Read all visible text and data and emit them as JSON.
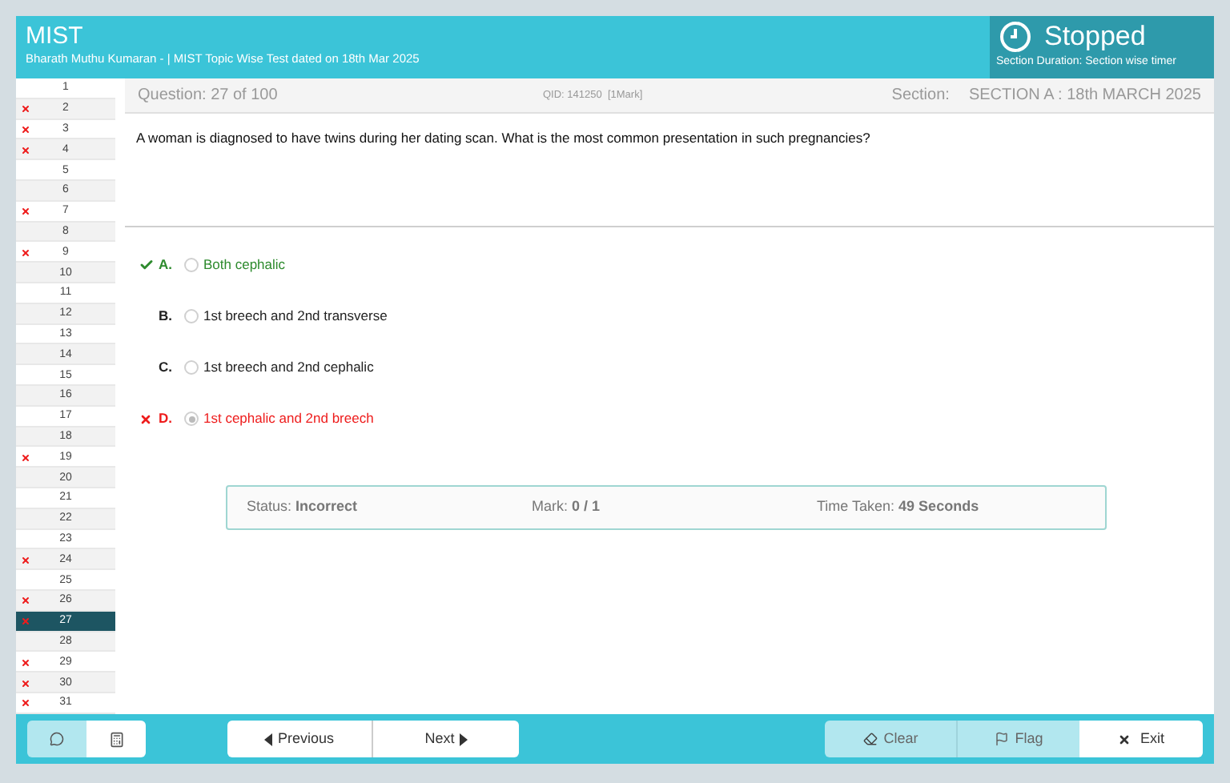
{
  "header": {
    "title": "MIST",
    "subtitle": "Bharath Muthu Kumaran - | MIST Topic Wise Test dated on 18th Mar 2025",
    "timer": {
      "state": "Stopped",
      "note": "Section Duration: Section wise timer"
    }
  },
  "questions": [
    {
      "number": "1",
      "wrong": false,
      "selected": false
    },
    {
      "number": "2",
      "wrong": true,
      "selected": false
    },
    {
      "number": "3",
      "wrong": true,
      "selected": false
    },
    {
      "number": "4",
      "wrong": true,
      "selected": false
    },
    {
      "number": "5",
      "wrong": false,
      "selected": false
    },
    {
      "number": "6",
      "wrong": false,
      "selected": false
    },
    {
      "number": "7",
      "wrong": true,
      "selected": false
    },
    {
      "number": "8",
      "wrong": false,
      "selected": false
    },
    {
      "number": "9",
      "wrong": true,
      "selected": false
    },
    {
      "number": "10",
      "wrong": false,
      "selected": false
    },
    {
      "number": "11",
      "wrong": false,
      "selected": false
    },
    {
      "number": "12",
      "wrong": false,
      "selected": false
    },
    {
      "number": "13",
      "wrong": false,
      "selected": false
    },
    {
      "number": "14",
      "wrong": false,
      "selected": false
    },
    {
      "number": "15",
      "wrong": false,
      "selected": false
    },
    {
      "number": "16",
      "wrong": false,
      "selected": false
    },
    {
      "number": "17",
      "wrong": false,
      "selected": false
    },
    {
      "number": "18",
      "wrong": false,
      "selected": false
    },
    {
      "number": "19",
      "wrong": true,
      "selected": false
    },
    {
      "number": "20",
      "wrong": false,
      "selected": false
    },
    {
      "number": "21",
      "wrong": false,
      "selected": false
    },
    {
      "number": "22",
      "wrong": false,
      "selected": false
    },
    {
      "number": "23",
      "wrong": false,
      "selected": false
    },
    {
      "number": "24",
      "wrong": true,
      "selected": false
    },
    {
      "number": "25",
      "wrong": false,
      "selected": false
    },
    {
      "number": "26",
      "wrong": true,
      "selected": false
    },
    {
      "number": "27",
      "wrong": true,
      "selected": true
    },
    {
      "number": "28",
      "wrong": false,
      "selected": false
    },
    {
      "number": "29",
      "wrong": true,
      "selected": false
    },
    {
      "number": "30",
      "wrong": true,
      "selected": false
    },
    {
      "number": "31",
      "wrong": true,
      "selected": false
    }
  ],
  "info_bar": {
    "question": "Question: 27 of 100",
    "qid": "QID: 141250  [1Mark]",
    "section_label": "Section:",
    "section": "SECTION A : 18th MARCH 2025"
  },
  "question_text": "A woman is diagnosed to have twins during her dating scan. What is the most common presentation in such pregnancies?",
  "options": [
    {
      "letter": "A.",
      "text": "Both cephalic",
      "kind": "correct",
      "selected": false
    },
    {
      "letter": "B.",
      "text": "1st breech and 2nd transverse",
      "kind": "plain",
      "selected": false
    },
    {
      "letter": "C.",
      "text": "1st breech and 2nd cephalic",
      "kind": "plain",
      "selected": false
    },
    {
      "letter": "D.",
      "text": "1st cephalic and 2nd breech",
      "kind": "wrong",
      "selected": true
    }
  ],
  "result": [
    {
      "label": "Status:",
      "value": "Incorrect"
    },
    {
      "label": "Mark:",
      "value": "0 / 1"
    },
    {
      "label": "Time Taken:",
      "value": "49 Seconds"
    }
  ],
  "footer": {
    "previous": "Previous",
    "next": "Next",
    "clear": "Clear",
    "flag": "Flag",
    "exit": "Exit"
  }
}
